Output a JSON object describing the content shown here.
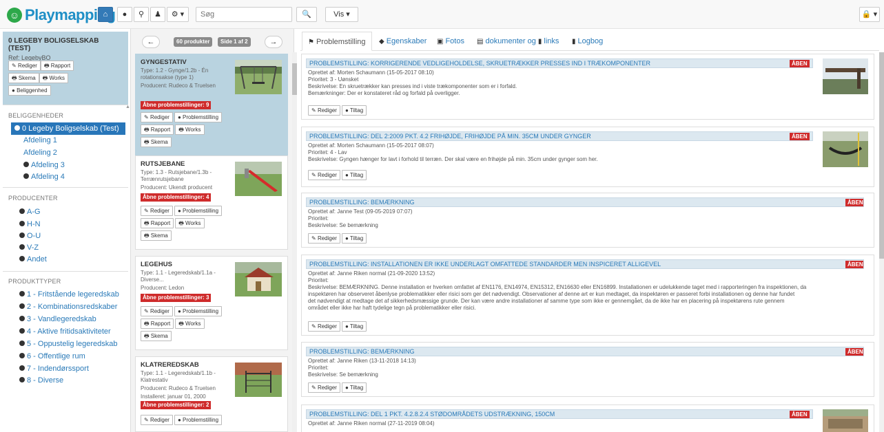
{
  "header": {
    "logo_text": "Playmapping",
    "search_placeholder": "Søg",
    "search_button": "🔍",
    "view_button": "Vis ▾",
    "lock_button": "🔒 ▾"
  },
  "property": {
    "title": "0 LEGEBY BOLIGSELSKAB (TEST)",
    "ref": "Ref: LegebyBO",
    "buttons": [
      "Rediger",
      "Rapport",
      "Skema",
      "Works",
      "Beliggenhed"
    ]
  },
  "sidebar": {
    "locations_header": "BELIGGENHEDER",
    "locations": [
      "0 Legeby Boligselskab (Test)",
      "Afdeling 1",
      "Afdeling 2",
      "Afdeling 3",
      "Afdeling 4"
    ],
    "producers_header": "PRODUCENTER",
    "producers": [
      "A-G",
      "H-N",
      "O-U",
      "V-Z",
      "Andet"
    ],
    "types_header": "PRODUKTTYPER",
    "types": [
      "1 - Fritstående legeredskab",
      "2 - Kombinationsredskaber",
      "3 - Vandlegeredskab",
      "4 - Aktive fritidsaktiviteter",
      "5 - Oppustelig legeredskab",
      "6 - Offentlige rum",
      "7 - Indendørssport",
      "8 - Diverse"
    ]
  },
  "products": {
    "count_label": "60 produkter",
    "page_label": "Side 1 af 2",
    "prev": "←",
    "next": "→",
    "btn_edit": "Rediger",
    "btn_problem": "Problemstilling",
    "btn_report": "Rapport",
    "btn_works": "Works",
    "btn_schema": "Skema",
    "items": [
      {
        "title": "GYNGESTATIV",
        "lines": [
          "Type: 1.2 - Gynge/1.2b - Én rotationsakse (type 1)",
          "Producent: Rudeco & Truelsen"
        ],
        "badge": "Åbne problemstillinger: 9"
      },
      {
        "title": "RUTSJEBANE",
        "lines": [
          "Type: 1.3 - Rutsjebane/1.3b - Terrænrutsjebane",
          "Producent: Ukendt producent"
        ],
        "badge": "Åbne problemstillinger: 4"
      },
      {
        "title": "LEGEHUS",
        "lines": [
          "Type: 1.1 - Legeredskab/1.1a - Diverse...",
          "Producent: Ledon"
        ],
        "badge": "Åbne problemstillinger: 3"
      },
      {
        "title": "KLATREREDSKAB",
        "lines": [
          "Type: 1.1 - Legeredskab/1.1b - Klatrestativ",
          "Producent: Rudeco & Truelsen",
          "Installeret: januar 01, 2000"
        ],
        "badge": "Åbne problemstillinger: 2"
      }
    ]
  },
  "tabs": [
    "Problemstilling",
    "Egenskaber",
    "Fotos",
    "dokumenter og",
    "links",
    "Logbog"
  ],
  "problems": {
    "btn_edit": "Rediger",
    "btn_action": "Tiltag",
    "items": [
      {
        "title": "PROBLEMSTILLING: KORRIGERENDE VEDLIGEHOLDELSE, SKRUETRÆKKER PRESSES IND I TRÆKOMPONENTER",
        "status": "ÅBEN",
        "lines": [
          "Oprettet af: Morten Schaumann (15-05-2017 08:10)",
          "Prioritet: 3 - Uønsket",
          "Beskrivelse: En skruetrækker kan presses ind i viste trækomponenter som er i forfald.",
          "Bemærkninger: Der er konstateret råd og forfald på overligger."
        ]
      },
      {
        "title": "PROBLEMSTILLING: DEL 2:2009 PKT. 4.2 FRIHØJDE, FRIHØJDE PÅ MIN. 35CM UNDER GYNGER",
        "status": "ÅBEN",
        "lines": [
          "Oprettet af: Morten Schaumann (15-05-2017 08:07)",
          "Prioritet: 4 - Lav",
          "Beskrivelse: Gyngen hænger for lavt i forhold til terræn. Der skal være en frihøjde på min. 35cm under gynger som her."
        ]
      },
      {
        "title": "PROBLEMSTILLING: BEMÆRKNING",
        "status": "ÅBEN",
        "lines": [
          "Oprettet af: Janne Test (09-05-2019 07:07)",
          "Prioritet:",
          "Beskrivelse: Se bemærkning"
        ]
      },
      {
        "title": "PROBLEMSTILLING: INSTALLATIONEN ER IKKE UNDERLAGT OMFATTEDE STANDARDER MEN INSPICERET ALLIGEVEL",
        "status": "ÅBEN",
        "lines": [
          "Oprettet af: Janne Riken normal (21-09-2020 13:52)",
          "Prioritet:",
          "Beskrivelse: BEMÆRKNING. Denne installation er hverken omfattet af EN1176, EN14974, EN15312, EN16630 eller EN16899. Installationen er udelukkende taget med i rapporteringen fra inspektionen, da",
          "inspektøren har observeret åbenlyse problematikker eller risici som ger det nødvendigt. Observationer af denne art er kun medtaget, da inspektøren er passeret forbi installationen og denne har fundet",
          "det nødvendigt at medtage det af sikkerhedsmæssige grunde. Der kan være andre installationer af samme type som ikke er gennemgået, da de ikke har en placering på inspektørens rute gennem",
          "området eller ikke har haft tydelige tegn på problematikker eller risici."
        ]
      },
      {
        "title": "PROBLEMSTILLING: BEMÆRKNING",
        "status": "ÅBEN",
        "lines": [
          "Oprettet af: Janne Riken (13-11-2018 14:13)",
          "Prioritet:",
          "Beskrivelse: Se bemærkning"
        ]
      },
      {
        "title": "PROBLEMSTILLING: DEL 1 PKT. 4.2.8.2.4 STØDOMRÅDETS UDSTRÆKNING, 150CM",
        "status": "ÅBEN",
        "lines": [
          "Oprettet af: Janne Riken normal (27-11-2019 08:04)"
        ]
      }
    ]
  }
}
